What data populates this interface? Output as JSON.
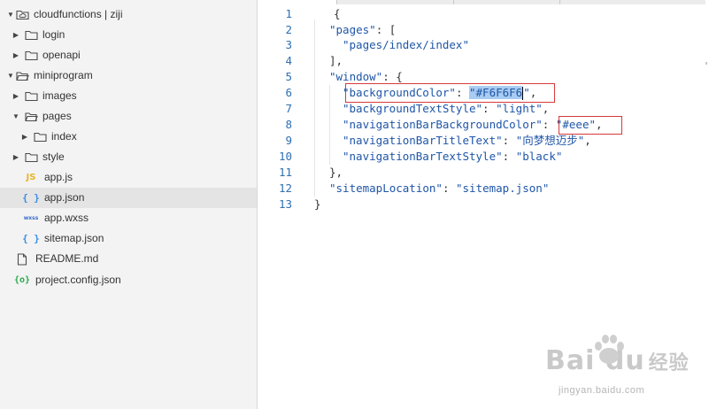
{
  "sidebar": {
    "items": [
      {
        "label": "cloudfunctions | ziji",
        "icon": "cloud-folder-icon",
        "kind": "folder",
        "expanded": true,
        "depth": 0
      },
      {
        "label": "login",
        "icon": "folder-icon",
        "kind": "folder",
        "expanded": false,
        "depth": 1
      },
      {
        "label": "openapi",
        "icon": "folder-icon",
        "kind": "folder",
        "expanded": false,
        "depth": 1
      },
      {
        "label": "miniprogram",
        "icon": "folder-open-icon",
        "kind": "folder",
        "expanded": true,
        "depth": 0
      },
      {
        "label": "images",
        "icon": "folder-icon",
        "kind": "folder",
        "expanded": false,
        "depth": 1
      },
      {
        "label": "pages",
        "icon": "folder-open-icon",
        "kind": "folder",
        "expanded": true,
        "depth": 1
      },
      {
        "label": "index",
        "icon": "folder-icon",
        "kind": "folder",
        "expanded": false,
        "depth": 2
      },
      {
        "label": "style",
        "icon": "folder-icon",
        "kind": "folder",
        "expanded": false,
        "depth": 1
      },
      {
        "label": "app.js",
        "icon": "js-file-icon",
        "badge": "JS",
        "kind": "file",
        "depth": 1
      },
      {
        "label": "app.json",
        "icon": "json-file-icon",
        "badge": "{ }",
        "kind": "file",
        "depth": 1,
        "selected": true
      },
      {
        "label": "app.wxss",
        "icon": "wxss-file-icon",
        "badge": "wxss",
        "kind": "file",
        "depth": 1
      },
      {
        "label": "sitemap.json",
        "icon": "json-file-icon",
        "badge": "{ }",
        "kind": "file",
        "depth": 1
      },
      {
        "label": "README.md",
        "icon": "file-icon",
        "kind": "file",
        "depth": 0
      },
      {
        "label": "project.config.json",
        "icon": "config-file-icon",
        "badge": "{o}",
        "kind": "file",
        "depth": 0
      }
    ]
  },
  "editor": {
    "lines": [
      {
        "num": "1",
        "text": "{"
      },
      {
        "num": "2",
        "text": "\"pages\": ["
      },
      {
        "num": "3",
        "text": "\"pages/index/index\""
      },
      {
        "num": "4",
        "text": "],"
      },
      {
        "num": "5",
        "text": "\"window\": {"
      },
      {
        "num": "6",
        "text": "\"backgroundColor\": \"#F6F6F6\","
      },
      {
        "num": "7",
        "text": "\"backgroundTextStyle\": \"light\","
      },
      {
        "num": "8",
        "text": "\"navigationBarBackgroundColor\": \"#eee\","
      },
      {
        "num": "9",
        "text": "\"navigationBarTitleText\": \"向梦想迈步\","
      },
      {
        "num": "10",
        "text": "\"navigationBarTextStyle\": \"black\""
      },
      {
        "num": "11",
        "text": "},"
      },
      {
        "num": "12",
        "text": "\"sitemapLocation\": \"sitemap.json\""
      },
      {
        "num": "13",
        "text": "}"
      }
    ],
    "selected_text": "\"#F6F6F6",
    "colors": {
      "string": "#1f56a8",
      "line_number": "#2d6fb4",
      "selection": "#a8ccf2",
      "highlight_box": "#d63a3a"
    }
  },
  "watermark": {
    "logo": "Bai du",
    "logo_suffix": "经验",
    "url": "jingyan.baidu.com"
  }
}
